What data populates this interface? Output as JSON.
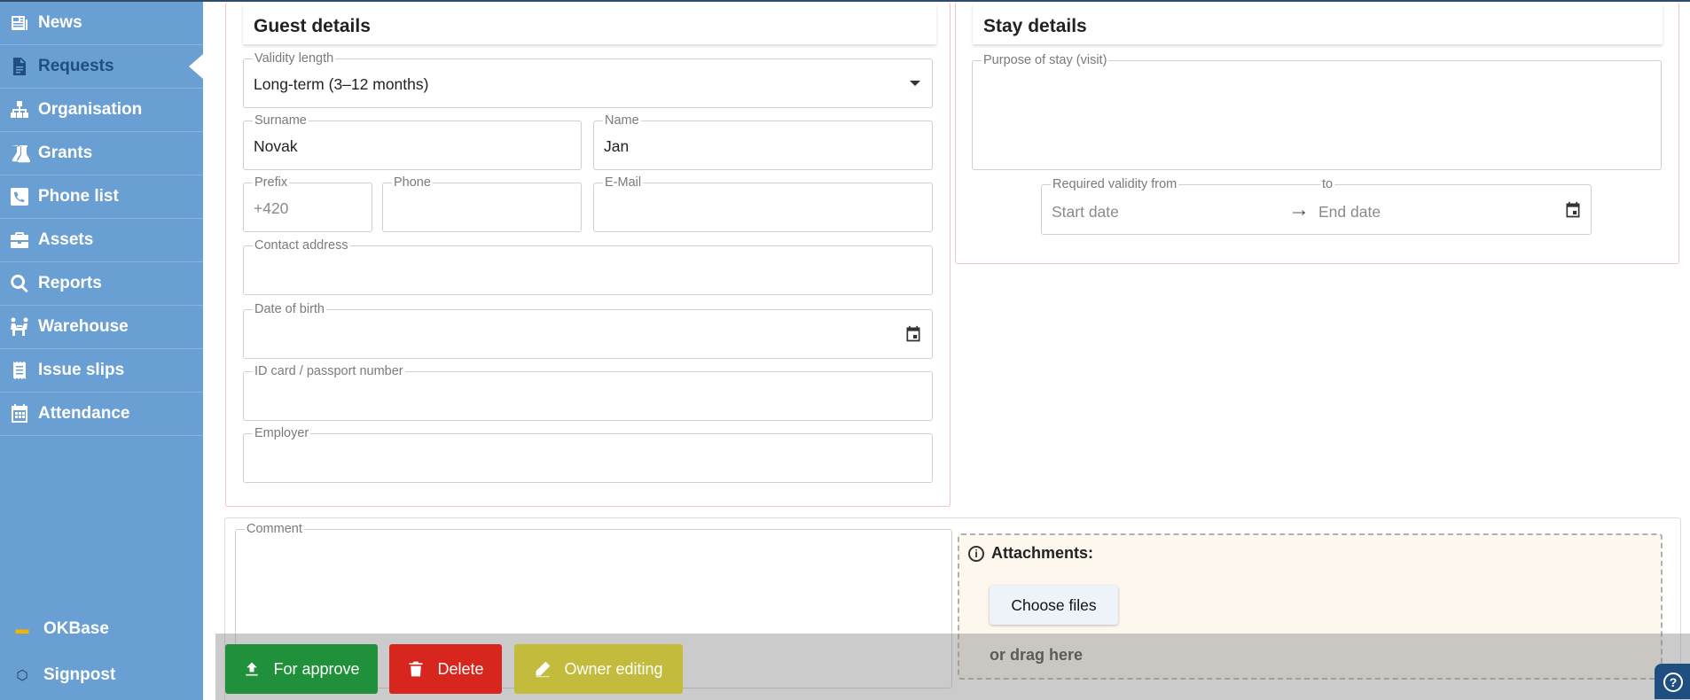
{
  "sidebar": {
    "items": [
      {
        "label": "News",
        "icon": "newspaper-icon"
      },
      {
        "label": "Requests",
        "icon": "document-icon"
      },
      {
        "label": "Organisation",
        "icon": "org-chart-icon"
      },
      {
        "label": "Grants",
        "icon": "flask-icon"
      },
      {
        "label": "Phone list",
        "icon": "phone-icon"
      },
      {
        "label": "Assets",
        "icon": "briefcase-icon"
      },
      {
        "label": "Reports",
        "icon": "search-icon"
      },
      {
        "label": "Warehouse",
        "icon": "people-carry-icon"
      },
      {
        "label": "Issue slips",
        "icon": "receipt-icon"
      },
      {
        "label": "Attendance",
        "icon": "calendar-icon"
      }
    ],
    "bottom": [
      {
        "label": "OKBase",
        "icon": "okbase-logo-icon"
      },
      {
        "label": "Signpost",
        "icon": "signpost-icon"
      }
    ]
  },
  "guest": {
    "title": "Guest details",
    "validity_label": "Validity length",
    "validity_value": "Long-term (3–12 months)",
    "surname_label": "Surname",
    "surname_value": "Novak",
    "name_label": "Name",
    "name_value": "Jan",
    "prefix_label": "Prefix",
    "prefix_placeholder": "+420",
    "phone_label": "Phone",
    "email_label": "E-Mail",
    "address_label": "Contact address",
    "dob_label": "Date of birth",
    "id_label": "ID card / passport number",
    "employer_label": "Employer"
  },
  "stay": {
    "title": "Stay details",
    "purpose_label": "Purpose of stay (visit)",
    "validity_from_label": "Required validity from",
    "to_label": "to",
    "start_placeholder": "Start date",
    "end_placeholder": "End date",
    "arrow": "→"
  },
  "comment": {
    "label": "Comment"
  },
  "attachments": {
    "title": "Attachments:",
    "info": "i",
    "choose": "Choose files",
    "drag": "or drag here"
  },
  "actions": {
    "approve": "For approve",
    "delete": "Delete",
    "owner": "Owner editing"
  },
  "help": "?",
  "colors": {
    "sidebar": "#6a9fd4",
    "active_text": "#1f4e80",
    "approve": "#20903a",
    "delete": "#d7261e",
    "owner": "#c2bb3c"
  }
}
